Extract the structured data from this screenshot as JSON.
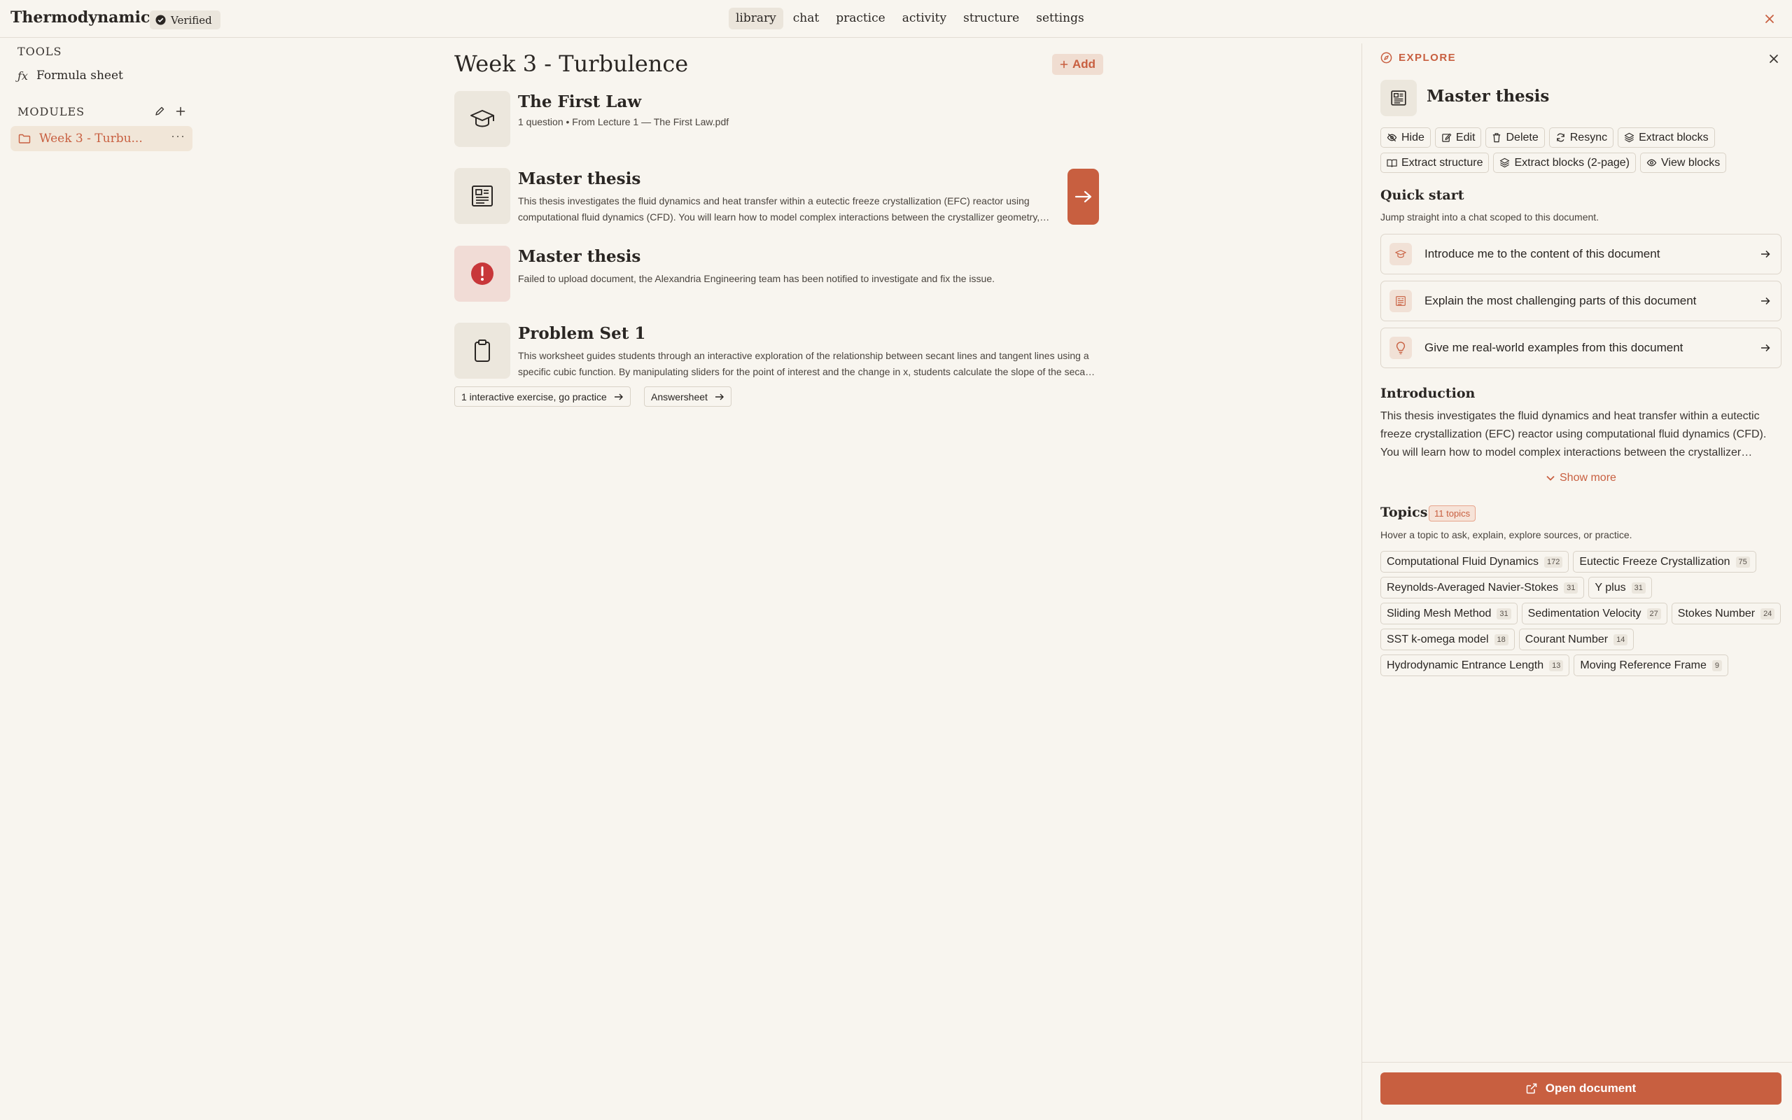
{
  "header": {
    "app_title": "Thermodynamics",
    "verified_label": "Verified",
    "nav": [
      {
        "label": "library",
        "active": true
      },
      {
        "label": "chat",
        "active": false
      },
      {
        "label": "practice",
        "active": false
      },
      {
        "label": "activity",
        "active": false
      },
      {
        "label": "structure",
        "active": false
      },
      {
        "label": "settings",
        "active": false
      }
    ]
  },
  "sidebar": {
    "tools_label": "TOOLS",
    "tools": [
      {
        "icon": "fx",
        "label": "Formula sheet"
      }
    ],
    "modules_label": "MODULES",
    "modules": [
      {
        "label": "Week 3 - Turbu...",
        "active": true
      }
    ]
  },
  "main": {
    "title": "Week 3 - Turbulence",
    "add_label": "Add",
    "documents": [
      {
        "icon": "graduation-cap-icon",
        "title": "The First Law",
        "meta": "1 question • From Lecture 1 — The First Law.pdf"
      },
      {
        "icon": "newspaper-icon",
        "title": "Master thesis",
        "description": "This thesis investigates the fluid dynamics and heat transfer within a eutectic freeze crystallization (EFC) reactor using computational fluid dynamics (CFD). You will learn how to model complex interactions between the crystallizer geometry, flow field, and heat transfer surfaces."
      },
      {
        "icon": "error-icon",
        "title": "Master thesis",
        "description": "Failed to upload document, the Alexandria Engineering team has been notified to investigate and fix the issue."
      },
      {
        "icon": "clipboard-icon",
        "title": "Problem Set 1",
        "description": "This worksheet guides students through an interactive exploration of the relationship between secant lines and tangent lines using a specific cubic function. By manipulating sliders for the point of interest and the change in x, students calculate the slope of the secant line."
      }
    ],
    "problem_set_links": {
      "practice": "1 interactive exercise, go practice",
      "answersheet": "Answersheet"
    }
  },
  "panel": {
    "explore_label": "EXPLORE",
    "title": "Master thesis",
    "actions_row1": [
      "Hide",
      "Edit",
      "Delete",
      "Resync",
      "Extract blocks"
    ],
    "actions_row2": [
      "Extract structure",
      "Extract blocks (2-page)",
      "View blocks"
    ],
    "quick_start": {
      "heading": "Quick start",
      "subtitle": "Jump straight into a chat scoped to this document.",
      "items": [
        "Introduce me to the content of this document",
        "Explain the most challenging parts of this document",
        "Give me real-world examples from this document"
      ]
    },
    "introduction": {
      "heading": "Introduction",
      "text": "This thesis investigates the fluid dynamics and heat transfer within a eutectic freeze crystallization (EFC) reactor using computational fluid dynamics (CFD). You will learn how to model complex interactions between the crystallizer geometry, flow field, and heat transfer surfaces.",
      "show_more": "Show more"
    },
    "topics": {
      "heading": "Topics",
      "badge": "11 topics",
      "hint": "Hover a topic to ask, explain, explore sources, or practice.",
      "rows": [
        [
          {
            "name": "Computational Fluid Dynamics",
            "count": "172"
          },
          {
            "name": "Eutectic Freeze Crystallization",
            "count": "75"
          }
        ],
        [
          {
            "name": "Reynolds-Averaged Navier-Stokes",
            "count": "31"
          },
          {
            "name": "Y plus",
            "count": "31"
          }
        ],
        [
          {
            "name": "Sliding Mesh Method",
            "count": "31"
          },
          {
            "name": "Sedimentation Velocity",
            "count": "27"
          },
          {
            "name": "Stokes Number",
            "count": "24"
          }
        ],
        [
          {
            "name": "SST k-omega model",
            "count": "18"
          },
          {
            "name": "Courant Number",
            "count": "14"
          }
        ],
        [
          {
            "name": "Hydrodynamic Entrance Length",
            "count": "13"
          },
          {
            "name": "Moving Reference Frame",
            "count": "9"
          }
        ]
      ]
    },
    "open_document_label": "Open document"
  },
  "colors": {
    "accent": "#c85f40",
    "background": "#f8f5ef",
    "error": "#c8373a"
  }
}
